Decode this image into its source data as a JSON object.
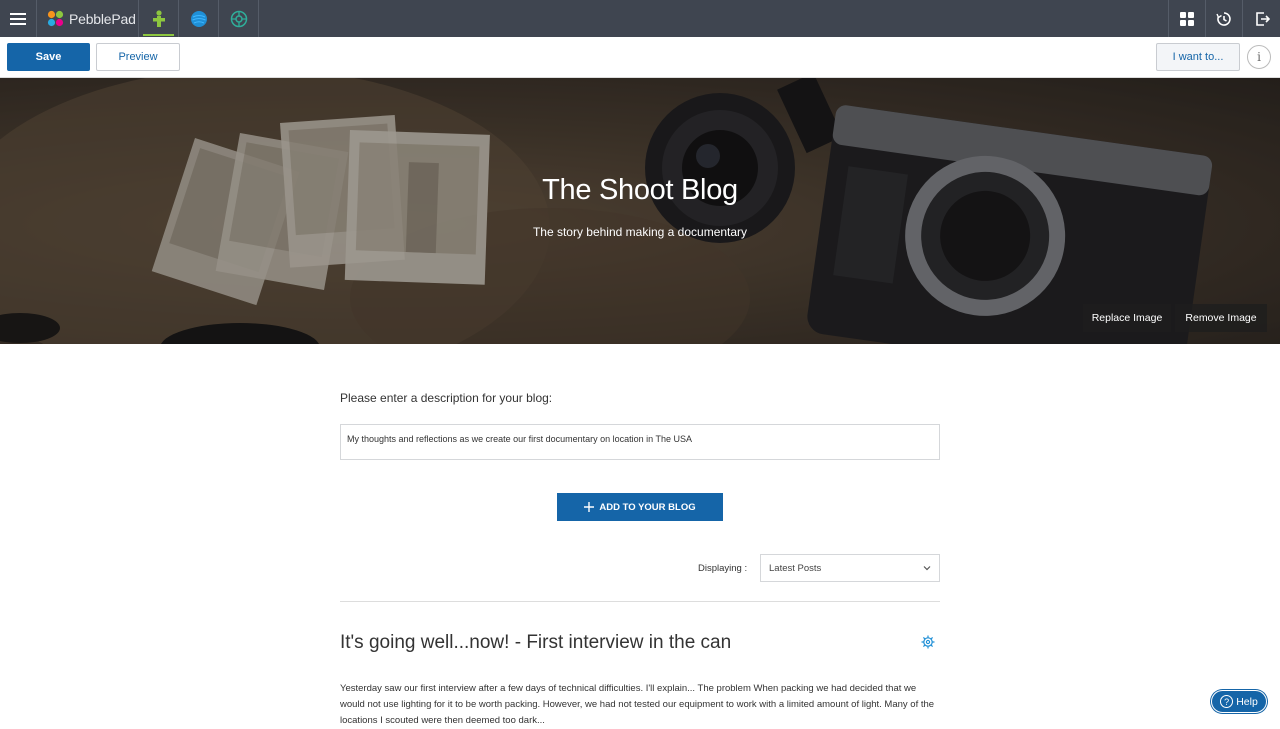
{
  "app": {
    "brand": "PebblePad"
  },
  "toolbar": {
    "save_label": "Save",
    "preview_label": "Preview",
    "iwant_label": "I want to...",
    "info_label": "i"
  },
  "hero": {
    "title": "The Shoot Blog",
    "subtitle": "The story behind making a documentary",
    "replace_label": "Replace Image",
    "remove_label": "Remove Image"
  },
  "description": {
    "label": "Please enter a description for your blog:",
    "value": "My thoughts and reflections as we create our first documentary on location in The USA"
  },
  "add_button": {
    "label": "ADD TO YOUR BLOG"
  },
  "displaying": {
    "label": "Displaying :",
    "selected": "Latest Posts"
  },
  "post": {
    "title": "It's going well...now! - First interview in the can",
    "body": "Yesterday saw our first interview after a few days of technical difficulties. I'll explain... The problem When packing we had decided that we would not use lighting for it to be worth packing. However, we had not tested our equipment to work with a limited amount of light. Many of the locations I scouted were then deemed too dark..."
  },
  "help": {
    "label": "Help",
    "q": "?"
  },
  "colors": {
    "topbar": "#3f4550",
    "primary": "#1565a8",
    "active_underline": "#8dc63f"
  }
}
